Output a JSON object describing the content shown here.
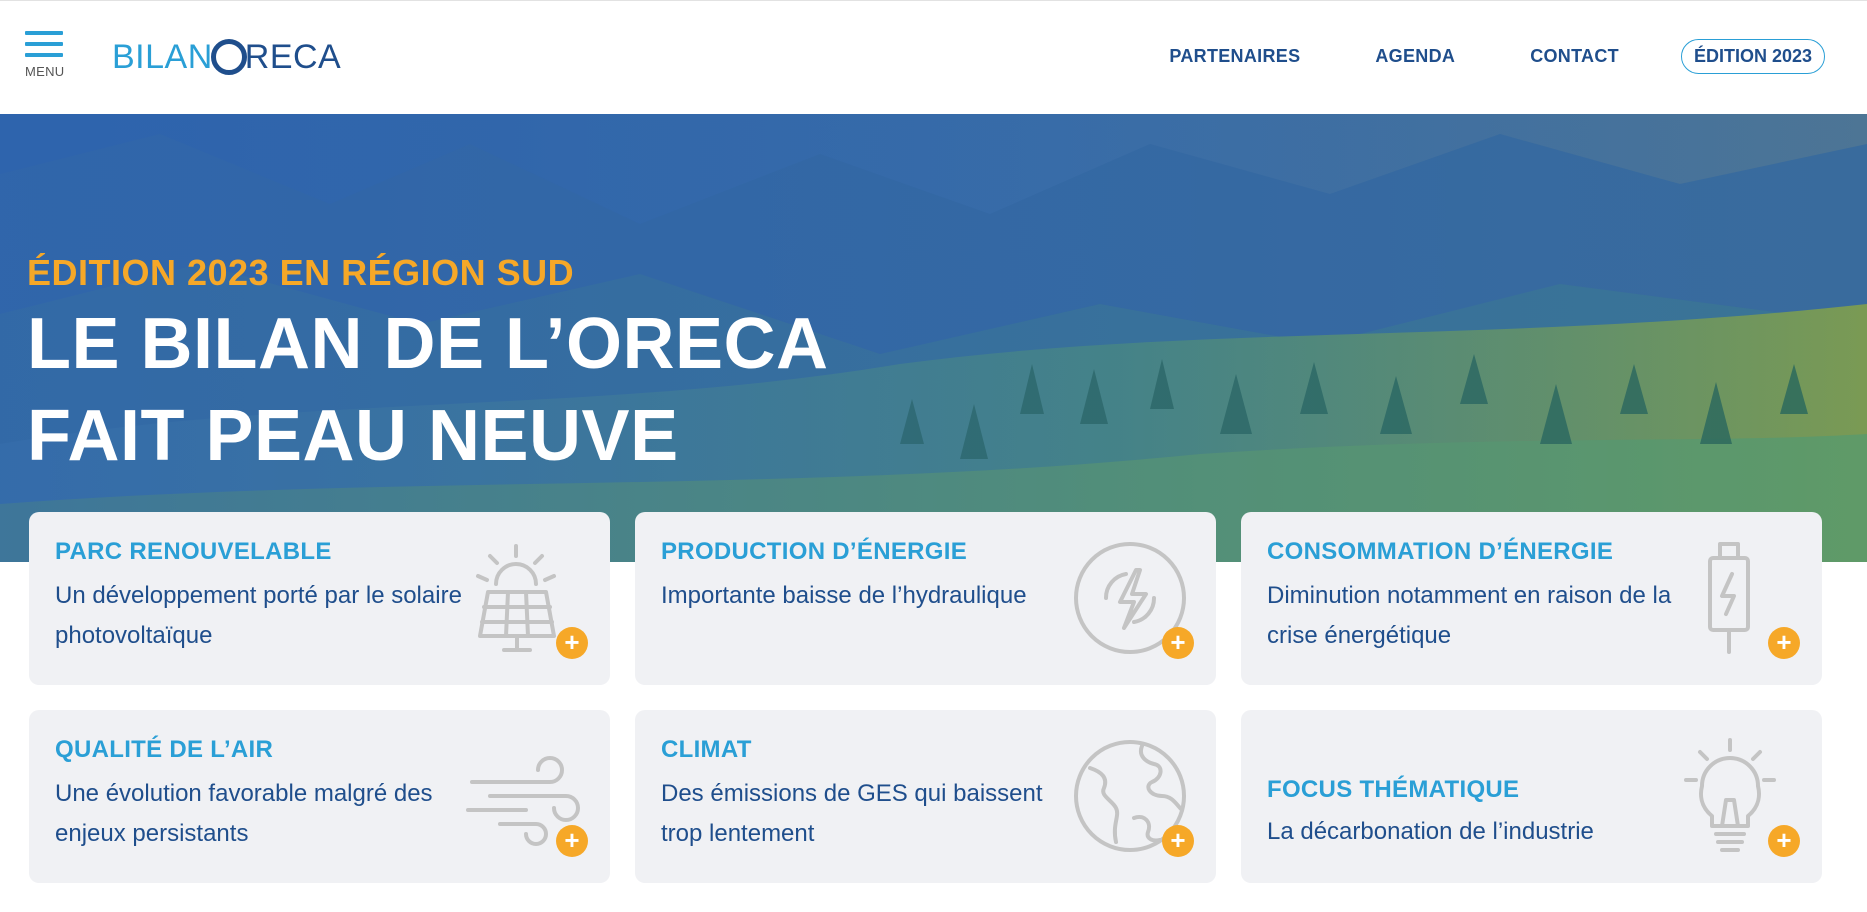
{
  "header": {
    "menu_label": "MENU",
    "logo": {
      "part1": "BILAN",
      "part2": "RECA"
    },
    "nav": [
      {
        "label": "PARTENAIRES"
      },
      {
        "label": "AGENDA"
      },
      {
        "label": "CONTACT"
      }
    ],
    "edition_label": "ÉDITION 2023"
  },
  "hero": {
    "subtitle": "ÉDITION 2023 EN RÉGION SUD",
    "title_line1": "LE BILAN DE L’ORECA",
    "title_line2": "FAIT PEAU NEUVE"
  },
  "cards": [
    {
      "title": "PARC RENOUVELABLE",
      "desc": "Un développement porté par le solaire photovoltaïque",
      "icon": "solar-panel-icon"
    },
    {
      "title": "PRODUCTION D’ÉNERGIE",
      "desc": "Importante baisse de l’hydraulique",
      "icon": "lightning-icon"
    },
    {
      "title": "CONSOMMATION D’ÉNERGIE",
      "desc": "Diminution notamment en raison de la crise énergétique",
      "icon": "battery-plug-icon"
    },
    {
      "title": "QUALITÉ DE L’AIR",
      "desc": "Une évolution favorable malgré des enjeux persistants",
      "icon": "wind-icon"
    },
    {
      "title": "CLIMAT",
      "desc": "Des émissions de GES qui baissent trop lentement",
      "icon": "globe-icon"
    },
    {
      "title": "FOCUS THÉMATIQUE",
      "desc": "La décarbonation de l’industrie",
      "icon": "light-bulb-icon"
    }
  ],
  "plus_symbol": "+",
  "colors": {
    "accent_blue": "#2a9fd6",
    "navy": "#1f4e8c",
    "orange": "#f6a828",
    "card_bg": "#f0f1f4",
    "icon_grey": "#c4c4c4"
  }
}
